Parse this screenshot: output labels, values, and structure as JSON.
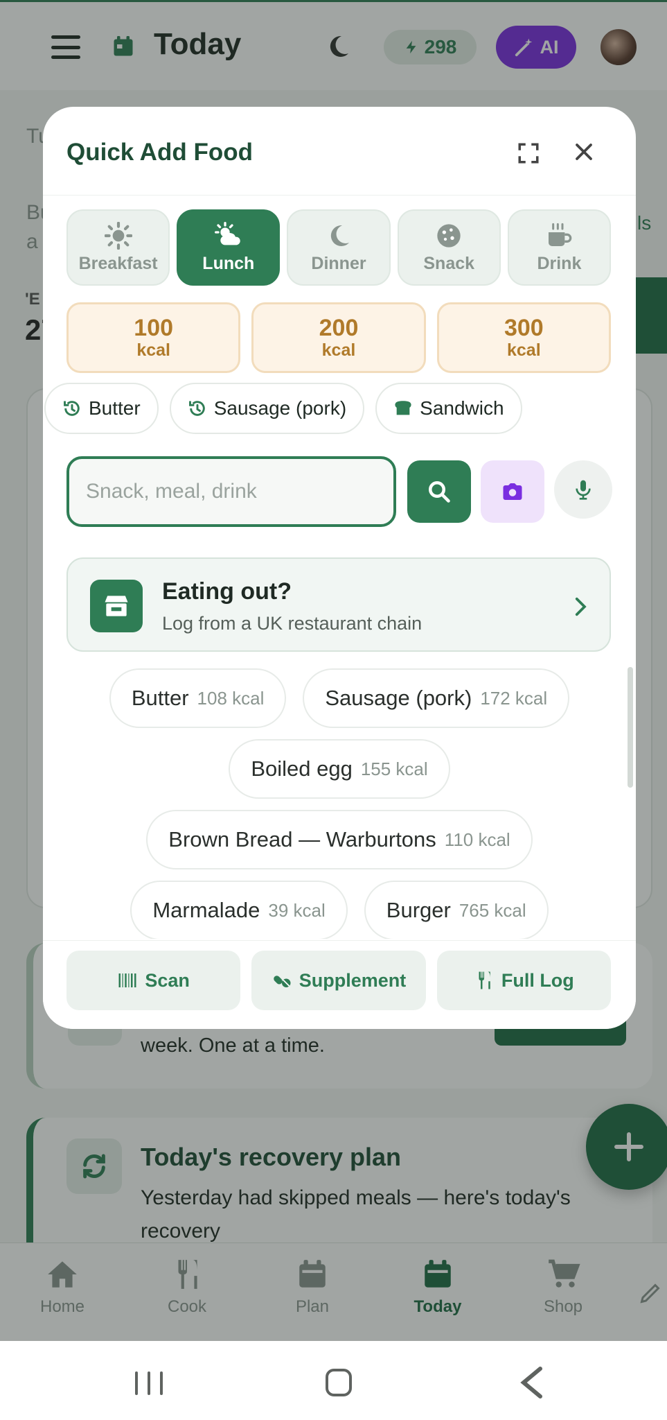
{
  "header": {
    "title": "Today",
    "energy_points": "298",
    "ai_label": "AI"
  },
  "background": {
    "text_a": "Tu",
    "text_b": "Bu\na",
    "text_c": "ls",
    "stat_label": "'E",
    "stat_value": "27",
    "tip_text": "week. One at a time.",
    "recovery_title": "Today's recovery plan",
    "recovery_desc": "Yesterday had skipped meals — here's today's recovery"
  },
  "modal": {
    "title": "Quick Add Food",
    "meals": [
      {
        "label": "Breakfast",
        "icon": "sun-icon",
        "active": false
      },
      {
        "label": "Lunch",
        "icon": "cloud-sun-icon",
        "active": true
      },
      {
        "label": "Dinner",
        "icon": "moon-icon",
        "active": false
      },
      {
        "label": "Snack",
        "icon": "cookie-icon",
        "active": false
      },
      {
        "label": "Drink",
        "icon": "mug-icon",
        "active": false
      }
    ],
    "kcal_presets": [
      {
        "value": "100",
        "unit": "kcal"
      },
      {
        "value": "200",
        "unit": "kcal"
      },
      {
        "value": "300",
        "unit": "kcal"
      }
    ],
    "recent": [
      {
        "label": "Butter",
        "icon": "history-icon"
      },
      {
        "label": "Sausage (pork)",
        "icon": "history-icon"
      },
      {
        "label": "Sandwich",
        "icon": "bread-icon"
      }
    ],
    "search": {
      "placeholder": "Snack, meal, drink",
      "value": ""
    },
    "eating_out": {
      "title": "Eating out?",
      "subtitle": "Log from a UK restaurant chain"
    },
    "foods": [
      [
        {
          "name": "Butter",
          "kcal": "108 kcal"
        },
        {
          "name": "Sausage (pork)",
          "kcal": "172 kcal"
        }
      ],
      [
        {
          "name": "Boiled egg",
          "kcal": "155 kcal"
        }
      ],
      [
        {
          "name": "Brown Bread — Warburtons",
          "kcal": "110 kcal"
        }
      ],
      [
        {
          "name": "Marmalade",
          "kcal": "39 kcal"
        },
        {
          "name": "Burger",
          "kcal": "765 kcal"
        }
      ]
    ],
    "footer": [
      {
        "label": "Scan",
        "icon": "barcode-icon"
      },
      {
        "label": "Supplement",
        "icon": "pills-icon"
      },
      {
        "label": "Full Log",
        "icon": "utensils-icon"
      }
    ]
  },
  "bottom_nav": [
    {
      "label": "Home",
      "icon": "home-icon",
      "active": false
    },
    {
      "label": "Cook",
      "icon": "utensils-icon",
      "active": false
    },
    {
      "label": "Plan",
      "icon": "calendar-icon",
      "active": false
    },
    {
      "label": "Today",
      "icon": "calendar-icon",
      "active": true
    },
    {
      "label": "Shop",
      "icon": "cart-icon",
      "active": false
    }
  ],
  "colors": {
    "primary": "#2f7d55",
    "primary_dark": "#1f6b45",
    "ai_purple": "#7a2ee0",
    "kcal_amber": "#b07a2a"
  }
}
